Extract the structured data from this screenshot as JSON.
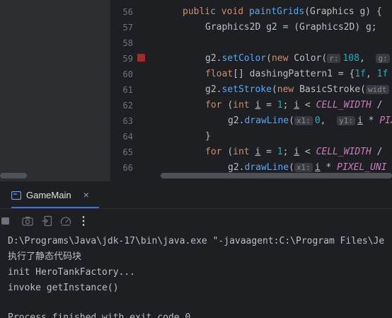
{
  "editor": {
    "line_numbers": [
      "56",
      "57",
      "58",
      "59",
      "60",
      "61",
      "62",
      "63",
      "64",
      "65",
      "66"
    ],
    "lines": {
      "l56": {
        "kw1": "public ",
        "kw2": "void ",
        "fn": "paintGrids",
        "rest": "(Graphics g) {"
      },
      "l57": {
        "text": "Graphics2D g2 = (Graphics2D) g;"
      },
      "l59": {
        "a": "g2.",
        "fn": "setColor",
        "b": "(",
        "kw": "new ",
        "c": "Color(",
        "hint_r": "r:",
        "num": "108",
        "d": ",  ",
        "hint_g": "g:"
      },
      "l60": {
        "kw": "float",
        "a": "[] dashingPattern1 = {",
        "n1": "1f",
        ",": ", ",
        "n2": "1f"
      },
      "l61": {
        "a": "g2.",
        "fn": "setStroke",
        "b": "(",
        "kw": "new ",
        "c": "BasicStroke(",
        "hint": "widt"
      },
      "l62": {
        "kw1": "for ",
        "a": "(",
        "kw2": "int ",
        "v1": "i",
        "b": " = ",
        "n": "1",
        "c": "; ",
        "v2": "i",
        "d": " < ",
        "const": "CELL_WIDTH",
        " e": " /"
      },
      "l63": {
        "a": "g2.",
        "fn": "drawLine",
        "b": "(",
        "hint_x1": "x1:",
        "n": "0",
        ",": ",  ",
        "hint_y1": "y1:",
        "v": "i",
        "c": " * ",
        "const": "PIX"
      },
      "l64": {
        "text": "}"
      },
      "l65": {
        "kw1": "for ",
        "a": "(",
        "kw2": "int ",
        "v1": "i",
        "b": " = ",
        "n": "1",
        "c": "; ",
        "v2": "i",
        "d": " < ",
        "const": "CELL_WIDTH",
        " e": " /"
      },
      "l66": {
        "a": "g2.",
        "fn": "drawLine",
        "b": "(",
        "hint_x1": "x1:",
        "v": "i",
        "c": " * ",
        "const": "PIXEL_UNI"
      }
    }
  },
  "tool_window": {
    "tab_label": "GameMain",
    "close_glyph": "×",
    "more_glyph": "⋮"
  },
  "console": {
    "lines": [
      "D:\\Programs\\Java\\jdk-17\\bin\\java.exe \"-javaagent:C:\\Program Files\\Je",
      "执行了静态代码块",
      "init HeroTankFactory...",
      "invoke getInstance()",
      "",
      "Process finished with exit code 0"
    ]
  },
  "colors": {
    "keyword": "#cf8e6d",
    "function": "#56a8f5",
    "number": "#2aacb8",
    "constant": "#c77dbb",
    "breakpoint": "#a02d2d",
    "tab_accent": "#3574f0"
  }
}
